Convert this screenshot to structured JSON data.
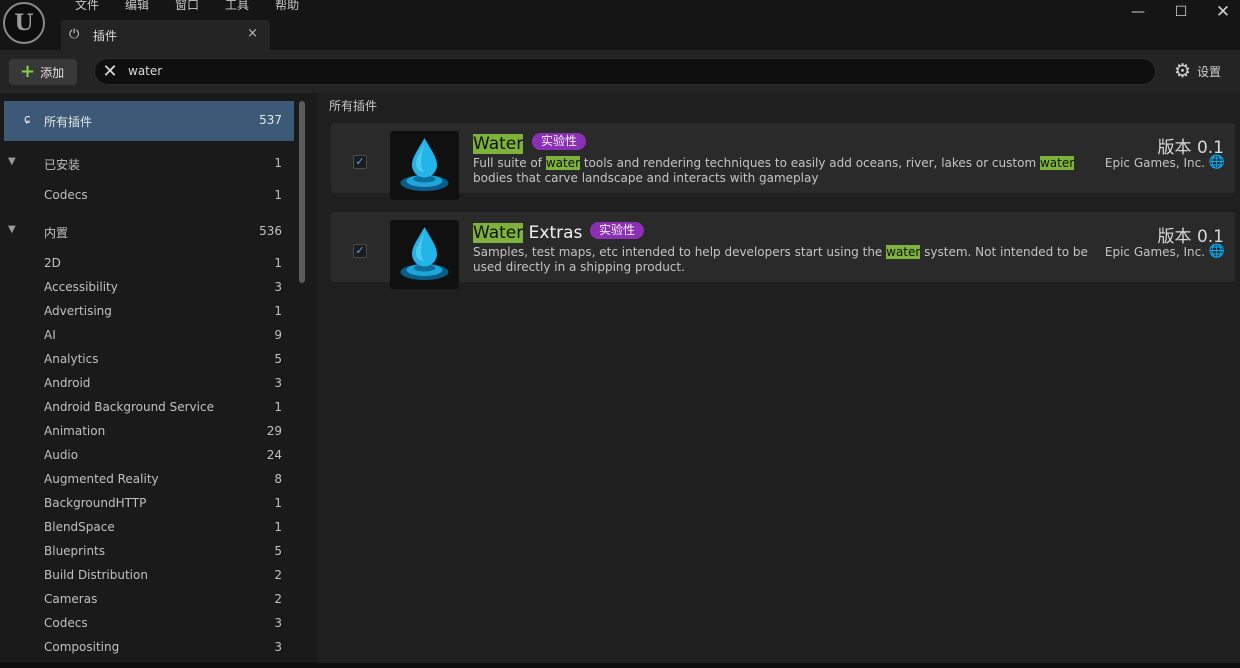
{
  "menu": [
    "文件",
    "编辑",
    "窗口",
    "工具",
    "帮助"
  ],
  "tab": {
    "label": "插件",
    "close": "×"
  },
  "toolbar": {
    "add_label": "添加",
    "search_value": "water",
    "settings_label": "设置"
  },
  "sidebar": {
    "all": {
      "label": "所有插件",
      "count": "537"
    },
    "installed": {
      "label": "已安装",
      "count": "1"
    },
    "installed_items": [
      {
        "label": "Codecs",
        "count": "1"
      }
    ],
    "builtin": {
      "label": "内置",
      "count": "536"
    },
    "builtin_items": [
      {
        "label": "2D",
        "count": "1"
      },
      {
        "label": "Accessibility",
        "count": "3"
      },
      {
        "label": "Advertising",
        "count": "1"
      },
      {
        "label": "AI",
        "count": "9"
      },
      {
        "label": "Analytics",
        "count": "5"
      },
      {
        "label": "Android",
        "count": "3"
      },
      {
        "label": "Android Background Service",
        "count": "1"
      },
      {
        "label": "Animation",
        "count": "29"
      },
      {
        "label": "Audio",
        "count": "24"
      },
      {
        "label": "Augmented Reality",
        "count": "8"
      },
      {
        "label": "BackgroundHTTP",
        "count": "1"
      },
      {
        "label": "BlendSpace",
        "count": "1"
      },
      {
        "label": "Blueprints",
        "count": "5"
      },
      {
        "label": "Build Distribution",
        "count": "2"
      },
      {
        "label": "Cameras",
        "count": "2"
      },
      {
        "label": "Codecs",
        "count": "3"
      },
      {
        "label": "Compositing",
        "count": "3"
      }
    ]
  },
  "main": {
    "header": "所有插件",
    "plugins": [
      {
        "title_hl": "Water",
        "title_rest": "",
        "badge": "实验性",
        "desc_parts": [
          "Full suite of ",
          "water",
          " tools and rendering techniques to easily add oceans, river, lakes or custom ",
          "water",
          " bodies that carve landscape and interacts with gameplay"
        ],
        "version": "版本 0.1",
        "vendor": "Epic Games, Inc.",
        "enabled": true
      },
      {
        "title_hl": "Water",
        "title_rest": " Extras",
        "badge": "实验性",
        "desc_parts": [
          "Samples, test maps, etc intended to help developers start using the ",
          "water",
          " system. Not intended to be used directly in a shipping product."
        ],
        "version": "版本 0.1",
        "vendor": "Epic Games, Inc.",
        "enabled": true
      }
    ]
  },
  "colors": {
    "accent_selected": "#3c5a78",
    "highlight": "#7db33c",
    "badge": "#8b2fb5",
    "checkbox": "#4aa3ff"
  }
}
